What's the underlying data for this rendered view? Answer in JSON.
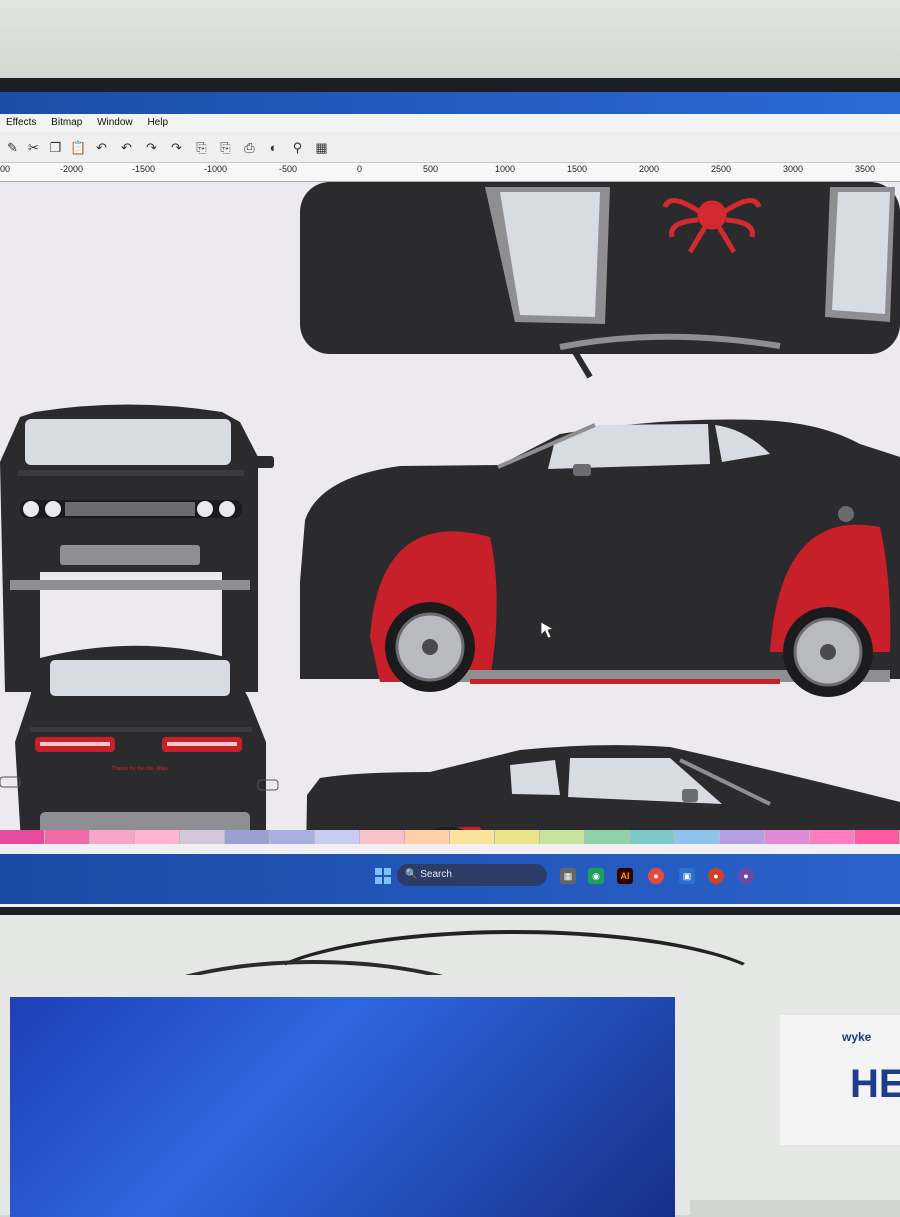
{
  "menu": {
    "items": [
      "Effects",
      "Bitmap",
      "Window",
      "Help"
    ]
  },
  "ruler": {
    "labels": [
      "00",
      "-2000",
      "-1500",
      "-1000",
      "-500",
      "0",
      "500",
      "1000",
      "1500",
      "2000",
      "2500",
      "3000",
      "3500"
    ]
  },
  "taskbar": {
    "search_placeholder": "Search",
    "apps": [
      "AI"
    ]
  },
  "car": {
    "back_text": "Thanks for the ride, Miles"
  },
  "brand": {
    "box_logo": "wyke",
    "box_text": "HE"
  },
  "colors": {
    "accent_red": "#c8202a",
    "car_body": "#2b2a2c",
    "glass": "#d9dbe3",
    "taskbar": "#1d4ab0"
  },
  "palette": [
    "#e84b9c",
    "#f06aa8",
    "#f7a6c8",
    "#ffb5cf",
    "#d2c7d8",
    "#9aa0cf",
    "#a9b0e0",
    "#c8ccf1",
    "#f6c1c9",
    "#ffd0a7",
    "#f9e39a",
    "#e9e38c",
    "#c8e39e",
    "#8fd1a9",
    "#7cc9c8",
    "#8ec3ee",
    "#b39fe2",
    "#df8ad6",
    "#ff7cc0",
    "#ff5a9e"
  ]
}
